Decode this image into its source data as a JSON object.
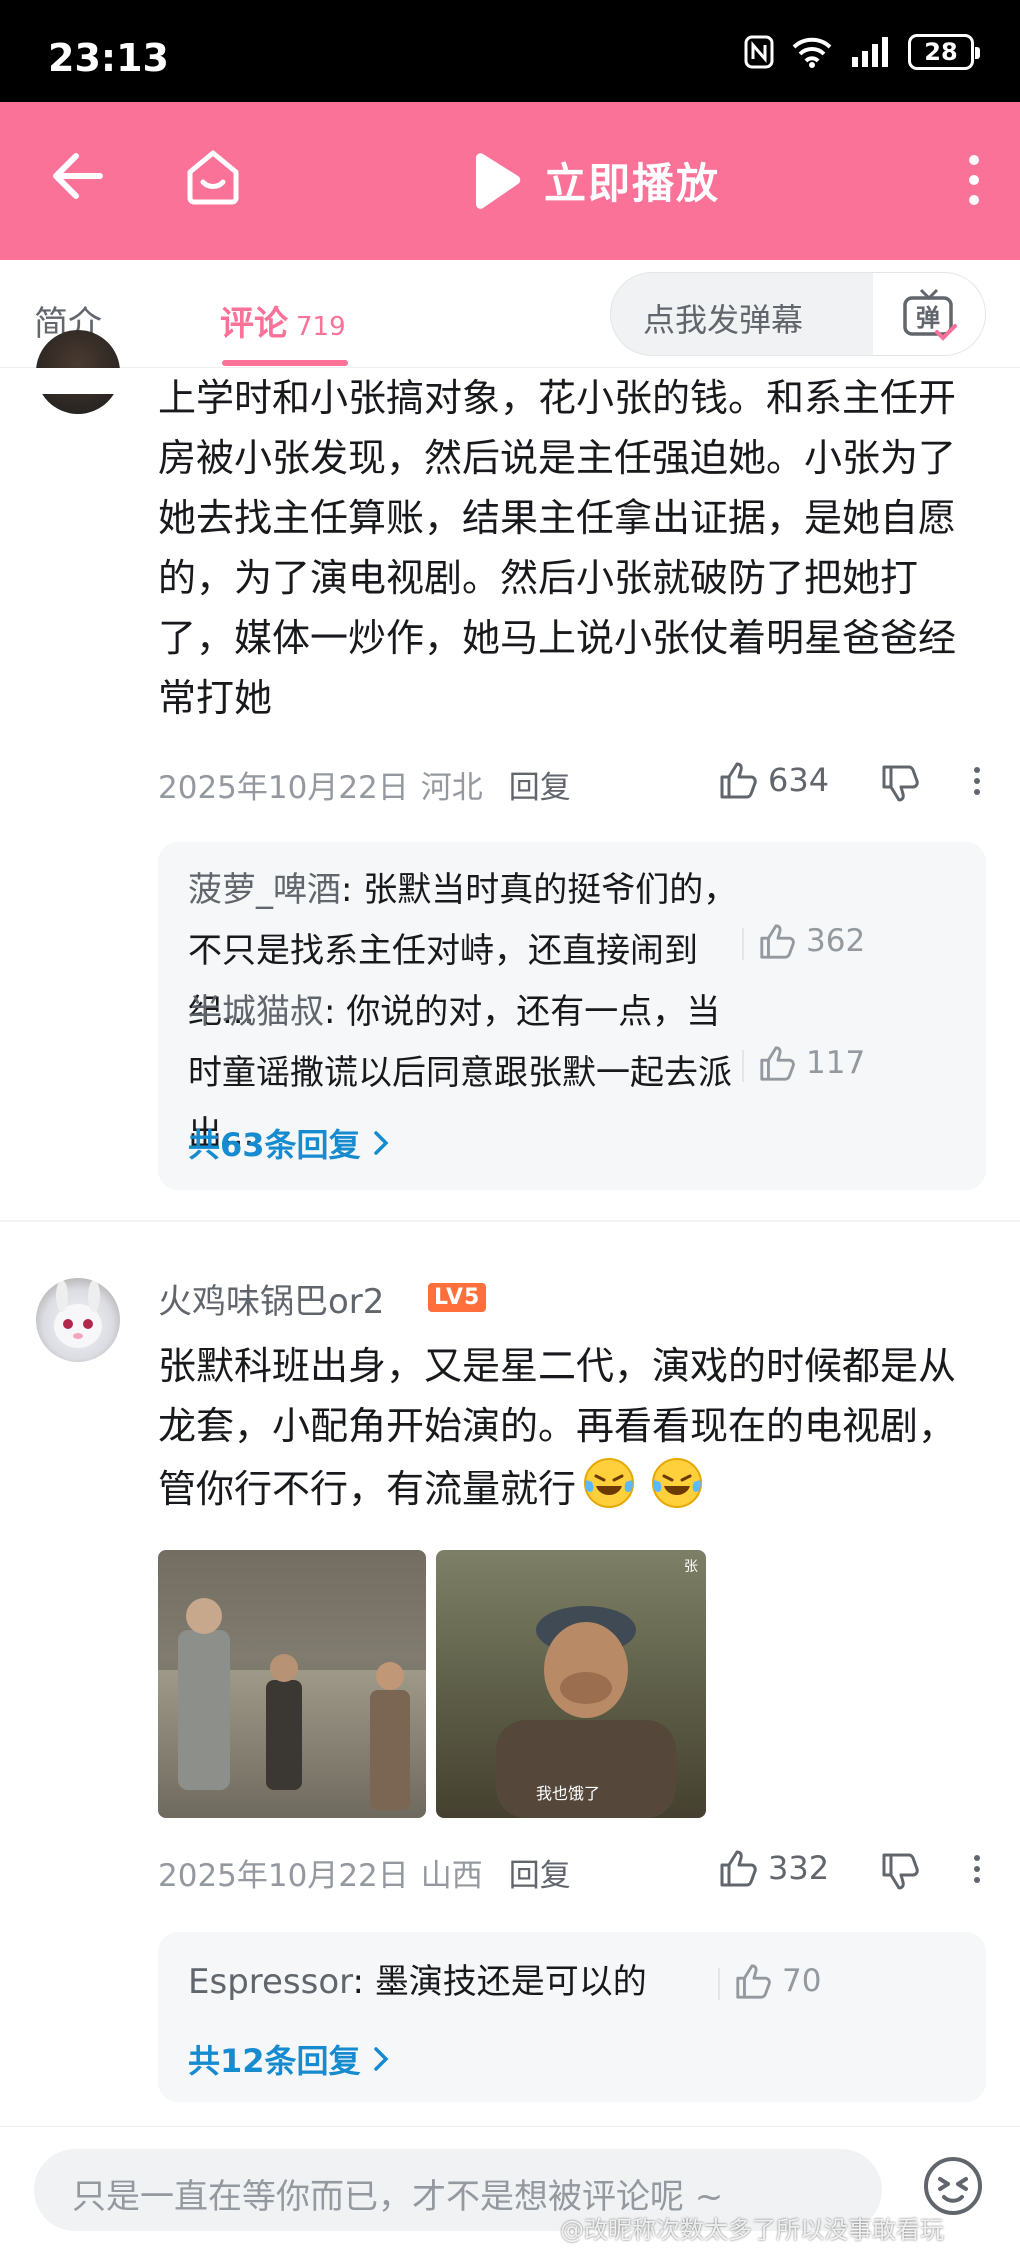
{
  "status_bar": {
    "time": "23:13",
    "battery": "28"
  },
  "header": {
    "play_label": "立即播放"
  },
  "tabs": {
    "intro": "简介",
    "comments": "评论",
    "comments_count": "719",
    "danmaku_placeholder": "点我发弹幕",
    "danmaku_icon_char": "弹"
  },
  "comment1": {
    "text": "上学时和小张搞对象，花小张的钱。和系主任开房被小张发现，然后说是主任强迫她。小张为了她去找主任算账，结果主任拿出证据，是她自愿的，为了演电视剧。然后小张就破防了把她打了，媒体一炒作，她马上说小张仗着明星爸爸经常打她",
    "date": "2025年10月22日",
    "region": "河北",
    "reply_label": "回复",
    "likes": "634",
    "replies": [
      {
        "user": "菠萝_啤酒",
        "text": "张默当时真的挺爷们的，不只是找系主任对峙，还直接闹到纪...",
        "likes": "362"
      },
      {
        "user": "半城猫叔",
        "text": "你说的对，还有一点，当时童谣撒谎以后同意跟张默一起去派出...",
        "likes": "117"
      }
    ],
    "more_replies": "共63条回复"
  },
  "comment2": {
    "user": "火鸡味锅巴or2",
    "level": "LV5",
    "text": "张默科班出身，又是星二代，演戏的时候都是从龙套，小配角开始演的。再看看现在的电视剧，管你行不行，有流量就行",
    "image2_caption": "我也饿了",
    "image2_mark": "张",
    "date": "2025年10月22日",
    "region": "山西",
    "reply_label": "回复",
    "likes": "332",
    "replies": [
      {
        "user": "Espressor",
        "text": "墨演技还是可以的",
        "likes": "70"
      }
    ],
    "more_replies": "共12条回复"
  },
  "bottom": {
    "input_placeholder": "只是一直在等你而已，才不是想被评论呢 ~",
    "watermark": "@改昵称次数太多了所以没事敢看玩"
  },
  "colors": {
    "brand_pink": "#fb7299",
    "link_blue": "#178bcf",
    "level_orange": "#ff6f3c"
  }
}
